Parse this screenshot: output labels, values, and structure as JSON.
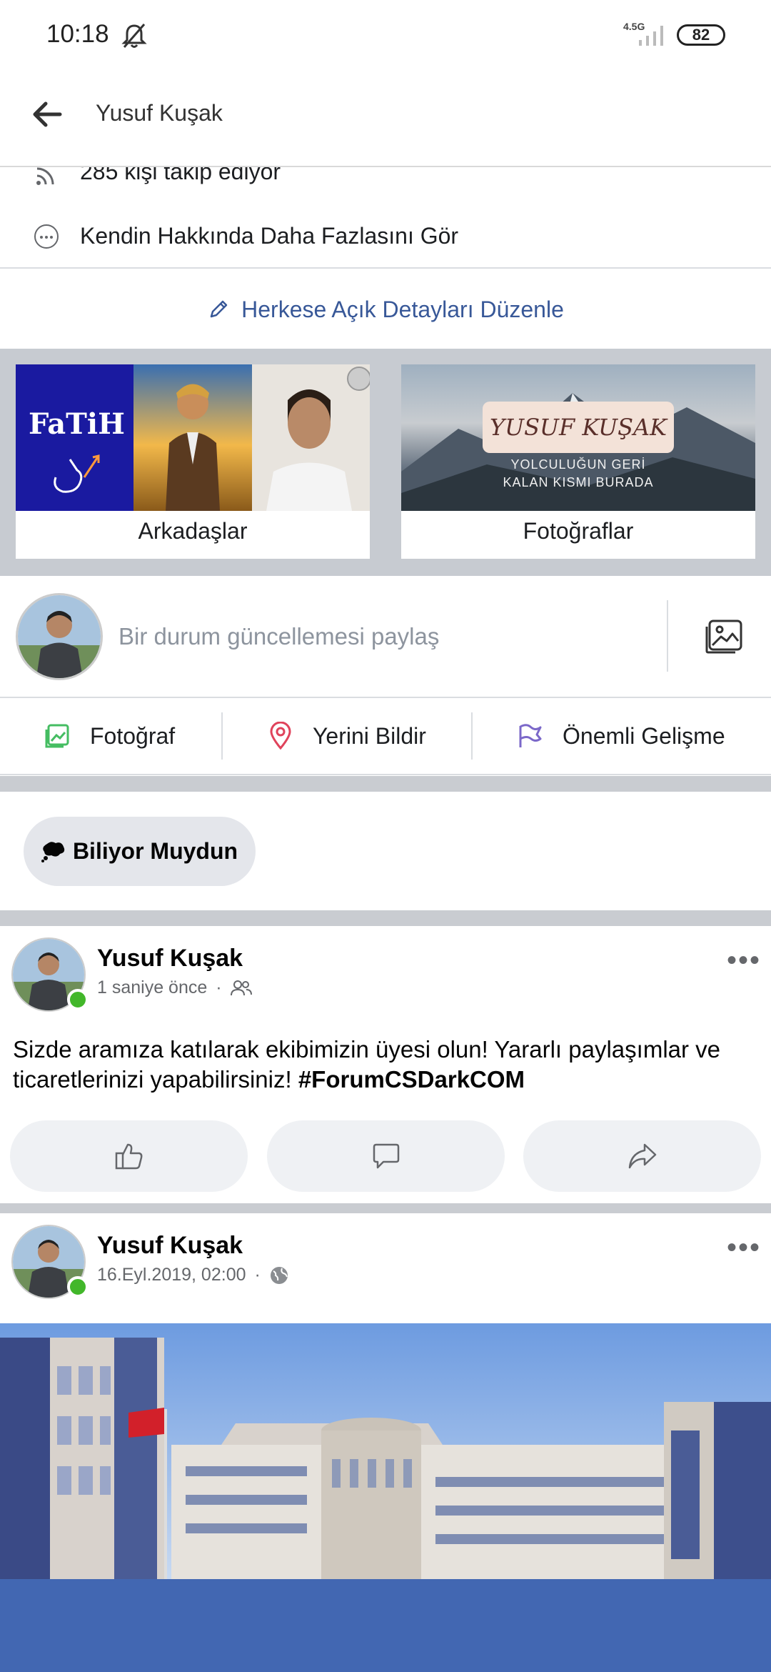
{
  "status_bar": {
    "time": "10:18",
    "network": "4.5G",
    "battery": "82"
  },
  "nav": {
    "title": "Yusuf Kuşak"
  },
  "about": {
    "followers_text": "285 kişi takip ediyor",
    "see_more_text": "Kendin Hakkında Daha Fazlasını Gör",
    "edit_public_details": "Herkese Açık Detayları Düzenle"
  },
  "cards": {
    "friends_label": "Arkadaşlar",
    "photos_label": "Fotoğraflar",
    "friend_logo_text": "FaTiH",
    "cover_title": "YUSUF KUŞAK",
    "cover_subtitle_line1": "YOLCULUĞUN GERİ",
    "cover_subtitle_line2": "KALAN KISMI BURADA"
  },
  "composer": {
    "placeholder": "Bir durum güncellemesi paylaş"
  },
  "actions": {
    "photo": "Fotoğraf",
    "checkin": "Yerini Bildir",
    "life_event": "Önemli Gelişme"
  },
  "chip": {
    "label": "Biliyor Muydun"
  },
  "posts": [
    {
      "author": "Yusuf Kuşak",
      "time": "1 saniye önce",
      "text": "Sizde aramıza katılarak ekibimizin üyesi olun! Yararlı paylaşımlar ve ticaretlerinizi yapabilirsiniz! ",
      "hashtag": "#ForumCSDarkCOM"
    },
    {
      "author": "Yusuf Kuşak",
      "time": "16.Eyl.2019, 02:00"
    }
  ],
  "colors": {
    "link": "#385898",
    "online": "#42b72a",
    "brand": "#4267b2"
  }
}
